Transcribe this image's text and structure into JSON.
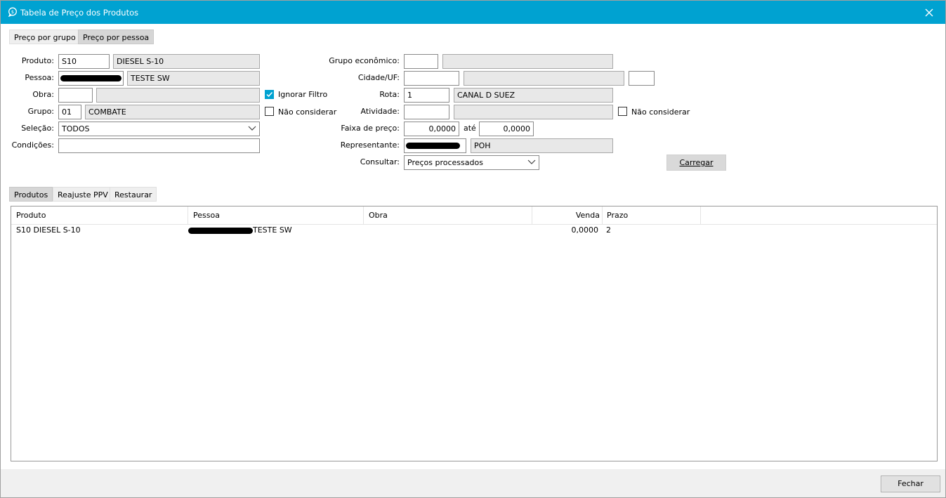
{
  "window": {
    "title": "Tabela de Preço dos Produtos"
  },
  "top_tabs": [
    "Preço por grupo",
    "Preço por pessoa"
  ],
  "form": {
    "produto_label": "Produto:",
    "produto_code": "S10",
    "produto_desc": "DIESEL S-10",
    "pessoa_label": "Pessoa:",
    "pessoa_desc": "TESTE SW",
    "obra_label": "Obra:",
    "obra_code": "",
    "obra_desc": "",
    "ignorar_filtro": "Ignorar Filtro",
    "grupo_label": "Grupo:",
    "grupo_code": "01",
    "grupo_desc": "COMBATE",
    "nao_considerar_1": "Não considerar",
    "selecao_label": "Seleção:",
    "selecao_value": "TODOS",
    "condicoes_label": "Condições:",
    "condicoes_value": "",
    "grupo_economico_label": "Grupo econômico:",
    "cidade_uf_label": "Cidade/UF:",
    "rota_label": "Rota:",
    "rota_code": "1",
    "rota_desc": "CANAL D SUEZ",
    "atividade_label": "Atividade:",
    "nao_considerar_2": "Não considerar",
    "faixa_label": "Faixa de preço:",
    "faixa_from": "0,0000",
    "ate_label": "até",
    "faixa_to": "0,0000",
    "representante_label": "Representante:",
    "representante_desc": "POH",
    "consultar_label": "Consultar:",
    "consultar_value": "Preços processados",
    "carregar_label": "Carregar"
  },
  "bottom_tabs": [
    "Produtos",
    "Reajuste PPV",
    "Restaurar"
  ],
  "table": {
    "columns": [
      "Produto",
      "Pessoa",
      "Obra",
      "Venda",
      "Prazo"
    ],
    "rows": [
      {
        "produto": "S10 DIESEL S-10",
        "pessoa": "TESTE SW",
        "obra": "",
        "venda": "0,0000",
        "prazo": "2"
      }
    ]
  },
  "footer": {
    "fechar_label": "Fechar"
  },
  "colors": {
    "accent": "#00a2d1"
  }
}
